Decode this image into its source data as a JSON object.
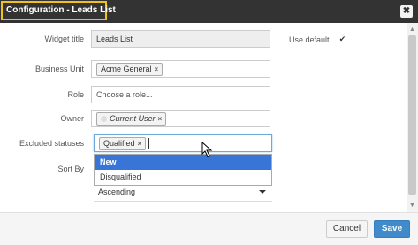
{
  "window": {
    "title": "Configuration - Leads List",
    "close_glyph": "✖"
  },
  "form": {
    "widget_title": {
      "label": "Widget title",
      "value": "Leads List"
    },
    "use_default": {
      "label": "Use default",
      "checked_glyph": "✔"
    },
    "business_unit": {
      "label": "Business Unit",
      "tag": "Acme General"
    },
    "role": {
      "label": "Role",
      "placeholder": "Choose a role..."
    },
    "owner": {
      "label": "Owner",
      "tag": "Current User"
    },
    "excluded_statuses": {
      "label": "Excluded statuses",
      "tag": "Qualified"
    },
    "sort_by": {
      "label": "Sort By",
      "value": "Ascending"
    }
  },
  "dropdown": {
    "options": [
      "New",
      "Disqualified"
    ]
  },
  "footer": {
    "cancel_label": "Cancel",
    "save_label": "Save"
  },
  "icons": {
    "tag_remove": "×",
    "scroll_up": "▲",
    "scroll_down": "▼"
  }
}
